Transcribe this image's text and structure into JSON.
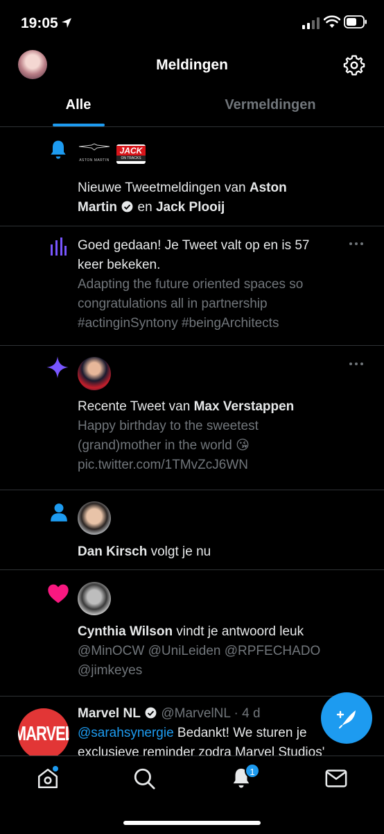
{
  "status_bar": {
    "time": "19:05"
  },
  "header": {
    "title": "Meldingen"
  },
  "tabs": {
    "all": "Alle",
    "mentions": "Vermeldingen"
  },
  "notifications": {
    "n1": {
      "icon": "bell-icon",
      "logo1": "ASTON MARTIN",
      "logo2_line1": "JACK",
      "logo2_line2": "ON TRACKS",
      "prefix": "Nieuwe Tweetmeldingen van ",
      "name1_a": "Aston",
      "name1_b": "Martin",
      "joiner": " en ",
      "name2": "Jack Plooij"
    },
    "n2": {
      "icon": "bar-chart-icon",
      "line1": "Goed gedaan! Je Tweet valt op en is 57",
      "line2": "keer bekeken.",
      "g1": "Adapting the future oriented spaces so",
      "g2": "congratulations all in partnership",
      "g3": "#actinginSyntony #beingArchitects"
    },
    "n3": {
      "icon": "sparkle-icon",
      "prefix": "Recente Tweet van ",
      "name": "Max Verstappen",
      "g1": "Happy birthday to the sweetest",
      "g2": "(grand)mother in the world 😘",
      "g3": "pic.twitter.com/1TMvZcJ6WN"
    },
    "n4": {
      "icon": "person-icon",
      "name": "Dan Kirsch",
      "suffix": " volgt je nu"
    },
    "n5": {
      "icon": "heart-icon",
      "name": "Cynthia Wilson",
      "suffix": " vindt je antwoord leuk",
      "g1": "@MinOCW @UniLeiden @RPFECHADO",
      "g2": "@jimkeyes"
    },
    "n6": {
      "avatar_text": "MARVEL",
      "name": "Marvel NL",
      "handle": "@MarvelNL · 4 d",
      "mention": "@sarahsynergie",
      "rest1": " Bedankt! We sturen je",
      "line2": "exclusieve reminder zodra Marvel Studios'"
    }
  },
  "tabbar": {
    "notif_badge": "1"
  },
  "colors": {
    "accent": "#1d9bf0",
    "heart": "#f91880",
    "purple": "#7856ff"
  }
}
